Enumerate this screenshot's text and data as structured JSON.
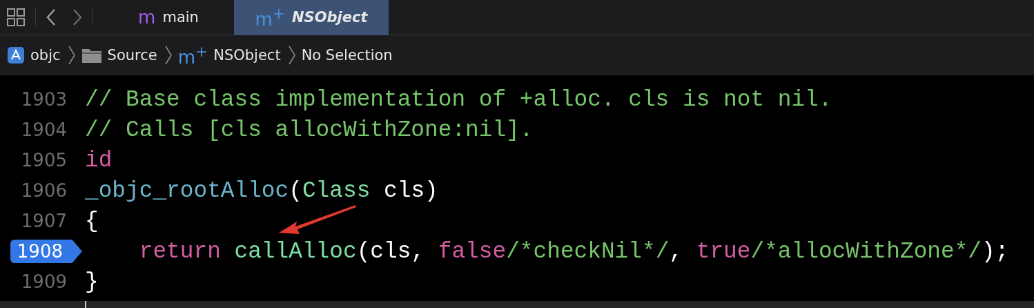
{
  "tabs": [
    {
      "icon": "m",
      "label": "main",
      "selected": false,
      "color": "#a35ae6"
    },
    {
      "icon": "m$^{+}$",
      "label": "NSObject",
      "selected": true,
      "color": "#4a8fe0"
    }
  ],
  "breadcrumb": [
    {
      "kind": "project",
      "label": "objc"
    },
    {
      "kind": "folder",
      "label": "Source"
    },
    {
      "kind": "file",
      "icon": "m$^{+}$",
      "label": "NSObject"
    },
    {
      "kind": "plain",
      "label": "No Selection"
    }
  ],
  "code": {
    "lines": [
      {
        "number": "1903",
        "breakpoint": false,
        "tokens": [
          {
            "kind": "comment",
            "text": "// Base class implementation of +alloc. cls is not nil."
          }
        ]
      },
      {
        "number": "1904",
        "breakpoint": false,
        "tokens": [
          {
            "kind": "comment",
            "text": "// Calls [cls allocWithZone:nil]."
          }
        ]
      },
      {
        "number": "1905",
        "breakpoint": false,
        "tokens": [
          {
            "kind": "keyword",
            "text": "id"
          }
        ]
      },
      {
        "number": "1906",
        "breakpoint": false,
        "tokens": [
          {
            "kind": "declaration",
            "text": "_objc_rootAlloc"
          },
          {
            "kind": "plain",
            "text": "("
          },
          {
            "kind": "type",
            "text": "Class"
          },
          {
            "kind": "plain",
            "text": " cls)"
          }
        ]
      },
      {
        "number": "1907",
        "breakpoint": false,
        "tokens": [
          {
            "kind": "plain",
            "text": "{"
          }
        ]
      },
      {
        "number": "1908",
        "breakpoint": true,
        "tokens": [
          {
            "kind": "keyword",
            "text": "    return"
          },
          {
            "kind": "type",
            "text": " callAlloc"
          },
          {
            "kind": "plain",
            "text": "(cls, "
          },
          {
            "kind": "keyword",
            "text": "false"
          },
          {
            "kind": "comment",
            "text": "/*checkNil*/"
          },
          {
            "kind": "plain",
            "text": ", "
          },
          {
            "kind": "keyword",
            "text": "true"
          },
          {
            "kind": "comment",
            "text": "/*allocWithZone*/"
          },
          {
            "kind": "plain",
            "text": ");"
          }
        ]
      },
      {
        "number": "1909",
        "breakpoint": false,
        "tokens": [
          {
            "kind": "plain",
            "text": "}"
          }
        ]
      }
    ]
  }
}
